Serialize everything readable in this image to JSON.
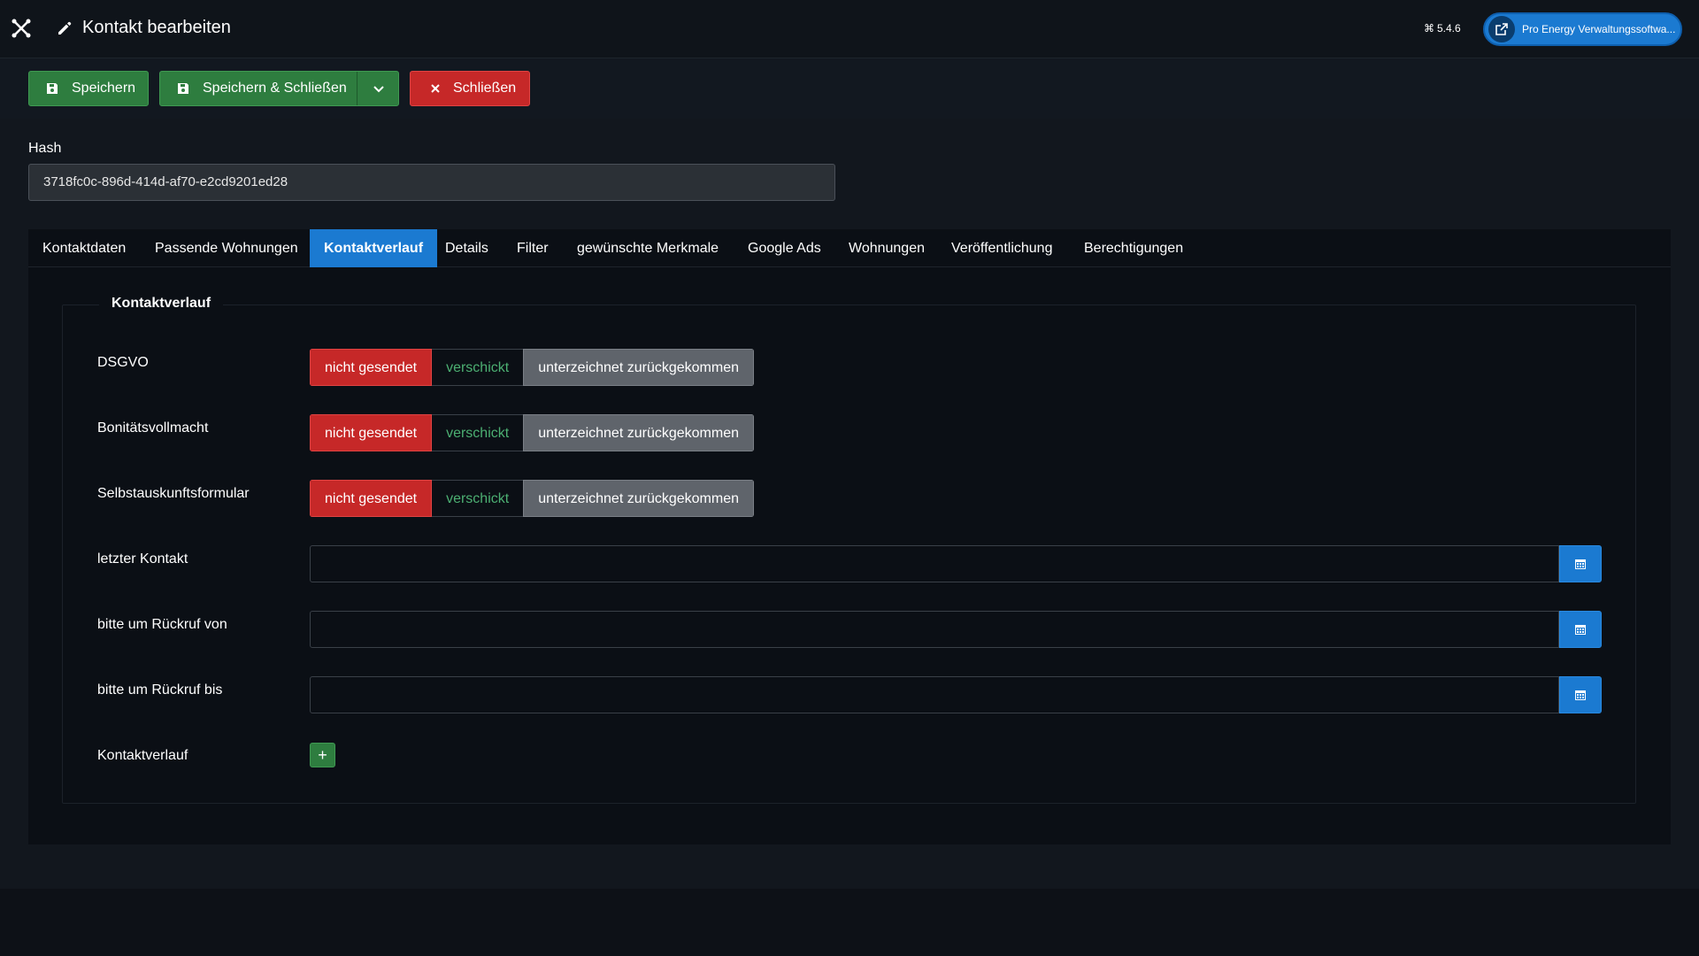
{
  "header": {
    "title": "Kontakt bearbeiten",
    "version": "5.4.6",
    "site_button_label": "Pro Energy Verwaltungssoftwa..."
  },
  "toolbar": {
    "save_label": "Speichern",
    "save_close_label": "Speichern & Schließen",
    "close_label": "Schließen"
  },
  "form": {
    "hash_label": "Hash",
    "hash_value": "3718fc0c-896d-414d-af70-e2cd9201ed28"
  },
  "tabs": [
    {
      "label": "Kontaktdaten"
    },
    {
      "label": "Passende Wohnungen"
    },
    {
      "label": "Kontaktverlauf"
    },
    {
      "label": "Details"
    },
    {
      "label": "Filter"
    },
    {
      "label": "gewünschte Merkmale"
    },
    {
      "label": "Google Ads"
    },
    {
      "label": "Wohnungen"
    },
    {
      "label": "Veröffentlichung"
    },
    {
      "label": "Berechtigungen"
    }
  ],
  "active_tab": "Kontaktverlauf",
  "fieldset": {
    "legend": "Kontaktverlauf",
    "status_rows": [
      {
        "label": "DSGVO",
        "options": [
          "nicht gesendet",
          "verschickt",
          "unterzeichnet zurückgekommen"
        ],
        "selected": "nicht gesendet"
      },
      {
        "label": "Bonitätsvollmacht",
        "options": [
          "nicht gesendet",
          "verschickt",
          "unterzeichnet zurückgekommen"
        ],
        "selected": "nicht gesendet"
      },
      {
        "label": "Selbstauskunftsformular",
        "options": [
          "nicht gesendet",
          "verschickt",
          "unterzeichnet zurückgekommen"
        ],
        "selected": "nicht gesendet"
      }
    ],
    "date_rows": [
      {
        "label": "letzter Kontakt",
        "value": ""
      },
      {
        "label": "bitte um Rückruf von",
        "value": ""
      },
      {
        "label": "bitte um Rückruf bis",
        "value": ""
      }
    ],
    "history_label": "Kontaktverlauf",
    "add_label": "+"
  },
  "colors": {
    "accent": "#1b7ad1",
    "success": "#2e7d3f",
    "danger": "#c62828",
    "background": "#0d1117"
  }
}
